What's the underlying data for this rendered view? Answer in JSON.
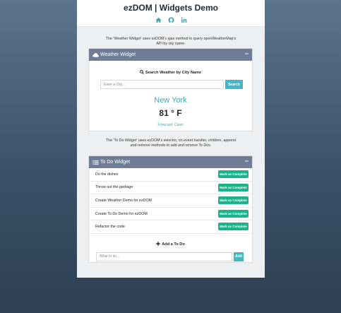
{
  "header": {
    "title": "ezDOM | Widgets Demo",
    "icons": [
      "home-icon",
      "github-icon",
      "linkedin-icon"
    ]
  },
  "weather_intro": "The 'Weather Widget' uses ezDOM's ajax method to query openWeatherMap's API by city name.",
  "weather_widget": {
    "title": "Weather Widget",
    "collapse_label": "−",
    "search_label": "Search Weather by City Name",
    "search_placeholder": "Enter a City...",
    "search_button": "Search",
    "city": "New York",
    "temperature": "81 ° F",
    "forecast": "Forecast: Clear"
  },
  "todo_intro": "The 'To Do Widget' uses ezDOM's selector, on event handler, children, append and remove methods to add and remove To Dos.",
  "todo_widget": {
    "title": "To Do Widget",
    "collapse_label": "−",
    "items": [
      {
        "text": "Do the dishes",
        "button": "Mark as Complete"
      },
      {
        "text": "Throw out the garbage",
        "button": "Mark as Complete"
      },
      {
        "text": "Create Weather Demo for ezDOM",
        "button": "Mark as Complete"
      },
      {
        "text": "Create To Do Demo for ezDOM",
        "button": "Mark as Complete"
      },
      {
        "text": "Refactor the code",
        "button": "Mark as Complete"
      }
    ],
    "add_label": "Add a To Do",
    "add_placeholder": "What to do...",
    "add_button": "Add"
  },
  "colors": {
    "accent": "#45b6c3",
    "panel_header": "#6f7e96",
    "complete_button": "#19b48b",
    "background_top": "#5b748c",
    "background_bottom": "#2c3f53"
  }
}
